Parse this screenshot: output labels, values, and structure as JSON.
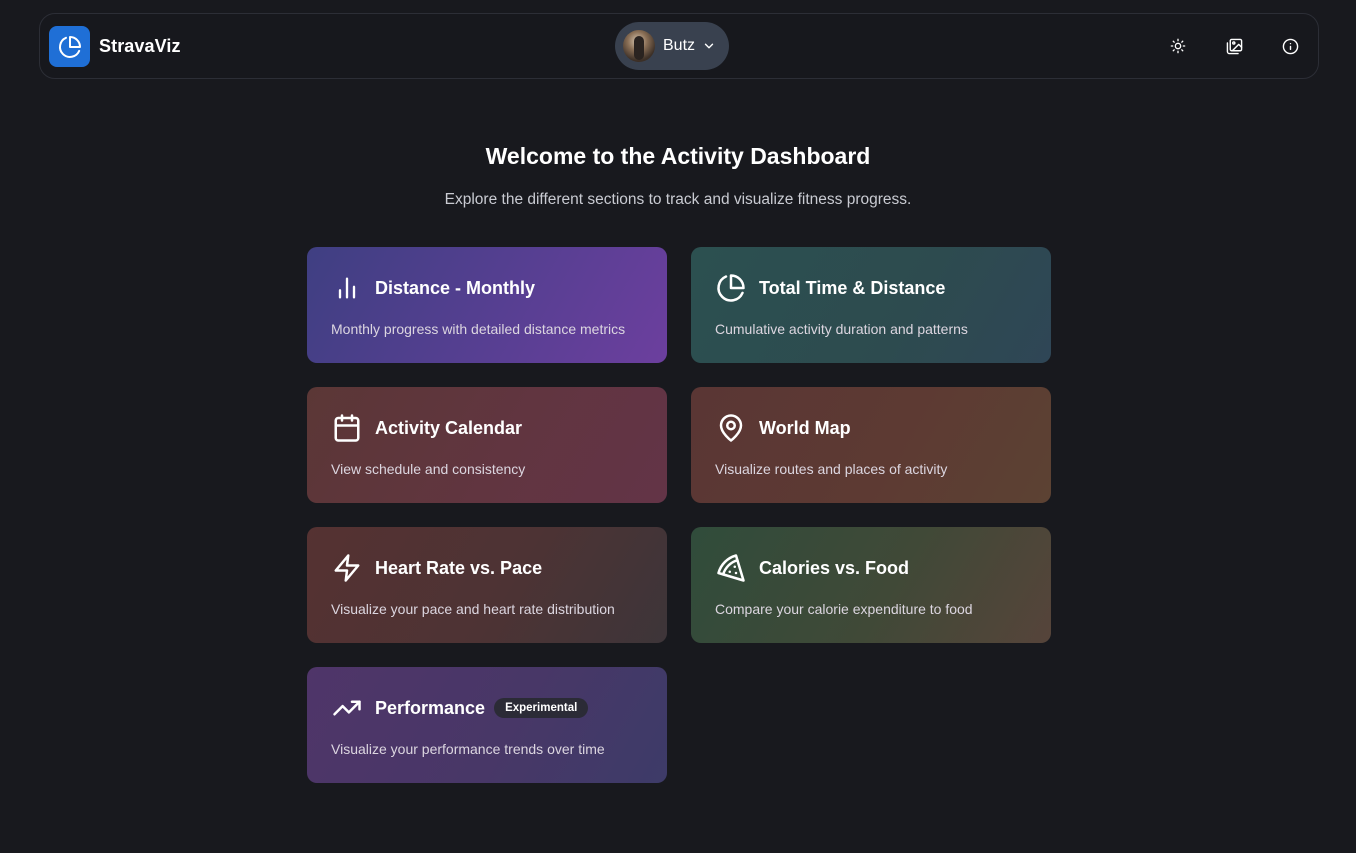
{
  "app": {
    "name": "StravaViz"
  },
  "user": {
    "name": "Butz"
  },
  "header_icons": [
    "sun-icon",
    "gallery-icon",
    "info-icon"
  ],
  "page": {
    "title": "Welcome to the Activity Dashboard",
    "subtitle": "Explore the different sections to track and visualize fitness progress."
  },
  "cards": [
    {
      "title": "Distance - Monthly",
      "description": "Monthly progress with detailed distance metrics",
      "icon": "bar-chart-icon"
    },
    {
      "title": "Total Time & Distance",
      "description": "Cumulative activity duration and patterns",
      "icon": "pie-chart-icon"
    },
    {
      "title": "Activity Calendar",
      "description": "View schedule and consistency",
      "icon": "calendar-icon"
    },
    {
      "title": "World Map",
      "description": "Visualize routes and places of activity",
      "icon": "map-pin-icon"
    },
    {
      "title": "Heart Rate vs. Pace",
      "description": "Visualize your pace and heart rate distribution",
      "icon": "lightning-icon"
    },
    {
      "title": "Calories vs. Food",
      "description": "Compare your calorie expenditure to food",
      "icon": "pizza-icon"
    },
    {
      "title": "Performance",
      "description": "Visualize your performance trends over time",
      "icon": "trending-up-icon",
      "badge": "Experimental"
    }
  ]
}
